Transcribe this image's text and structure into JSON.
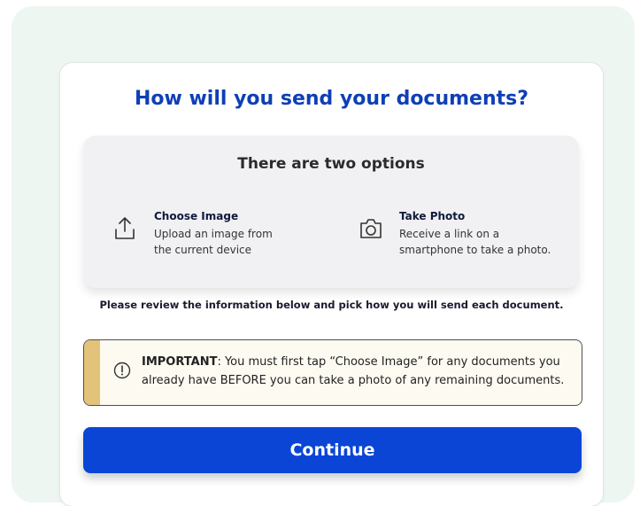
{
  "page": {
    "heading": "How will you send your documents?",
    "options_box": {
      "title": "There are two options",
      "choose_image": {
        "icon": "upload-icon",
        "title": "Choose Image",
        "desc_line1": "Upload an image from",
        "desc_line2": "the current device"
      },
      "take_photo": {
        "icon": "camera-icon",
        "title": "Take Photo",
        "desc_line1": "Receive a link on a",
        "desc_line2": "smartphone to take a photo."
      }
    },
    "review_text": "Please review the information below and pick how you will send each document.",
    "important": {
      "icon": "alert-circle-icon",
      "label": "IMPORTANT",
      "text_rest": ": You must first tap “Choose Image” for any documents you already have BEFORE you can take a photo of any remaining documents."
    },
    "continue_label": "Continue"
  },
  "colors": {
    "accent": "#0a45d6",
    "heading": "#0f3fb6",
    "important_bar": "#e3c27a",
    "important_bg": "#fdfbf1",
    "outer_bg": "#eef6f1"
  }
}
